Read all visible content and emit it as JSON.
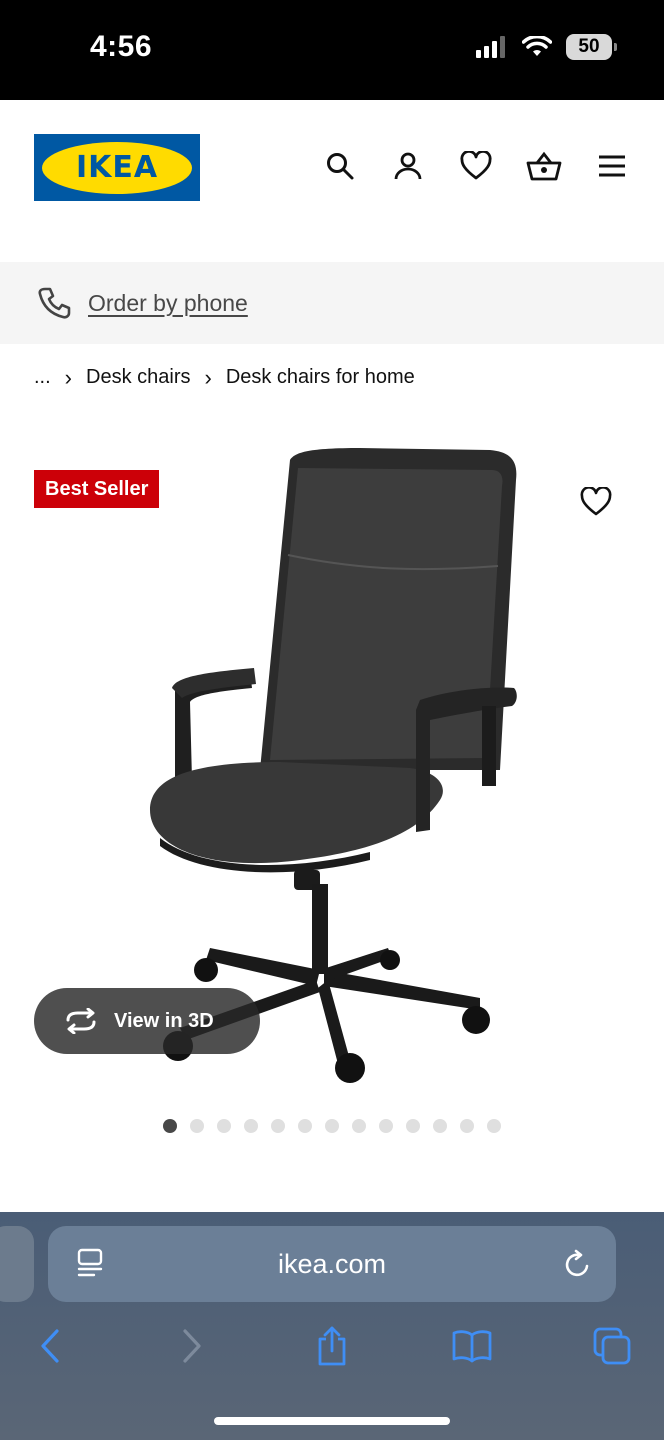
{
  "status_bar": {
    "time": "4:56",
    "battery": "50"
  },
  "header": {
    "logo_text": "IKEA",
    "icons": [
      "search-icon",
      "account-icon",
      "favorites-icon",
      "cart-icon",
      "menu-icon"
    ]
  },
  "order_bar": {
    "link_label": "Order by phone"
  },
  "breadcrumb": {
    "ellipsis": "...",
    "items": [
      "Desk chairs",
      "Desk chairs for home"
    ]
  },
  "product": {
    "badge": "Best Seller",
    "view3d_label": "View in 3D",
    "image_count": 13,
    "active_image": 1
  },
  "browser": {
    "url": "ikea.com"
  },
  "colors": {
    "ikea_blue": "#0058a3",
    "ikea_yellow": "#ffdb00",
    "badge_red": "#cc0008",
    "safari_accent": "#3f8ef5"
  }
}
